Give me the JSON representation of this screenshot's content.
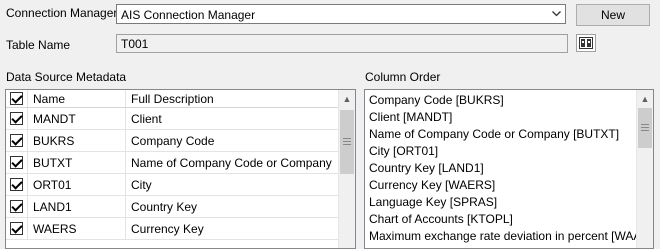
{
  "connection": {
    "label": "Connection Manager",
    "value": "AIS Connection Manager",
    "new_button": "New"
  },
  "table": {
    "label": "Table Name",
    "value": "T001"
  },
  "metadata": {
    "label": "Data Source Metadata",
    "headers": {
      "name": "Name",
      "description": "Full Description"
    },
    "rows": [
      {
        "name": "MANDT",
        "description": "Client",
        "checked": true
      },
      {
        "name": "BUKRS",
        "description": "Company Code",
        "checked": true
      },
      {
        "name": "BUTXT",
        "description": "Name of Company Code or Company",
        "checked": true
      },
      {
        "name": "ORT01",
        "description": "City",
        "checked": true
      },
      {
        "name": "LAND1",
        "description": "Country Key",
        "checked": true
      },
      {
        "name": "WAERS",
        "description": "Currency Key",
        "checked": true
      }
    ]
  },
  "column_order": {
    "label": "Column Order",
    "items": [
      "Company Code [BUKRS]",
      "Client [MANDT]",
      "Name of Company Code or Company [BUTXT]",
      "City [ORT01]",
      "Country Key [LAND1]",
      "Currency Key [WAERS]",
      "Language Key [SPRAS]",
      "Chart of Accounts [KTOPL]",
      "Maximum exchange rate deviation in percent [WAABW]"
    ]
  }
}
